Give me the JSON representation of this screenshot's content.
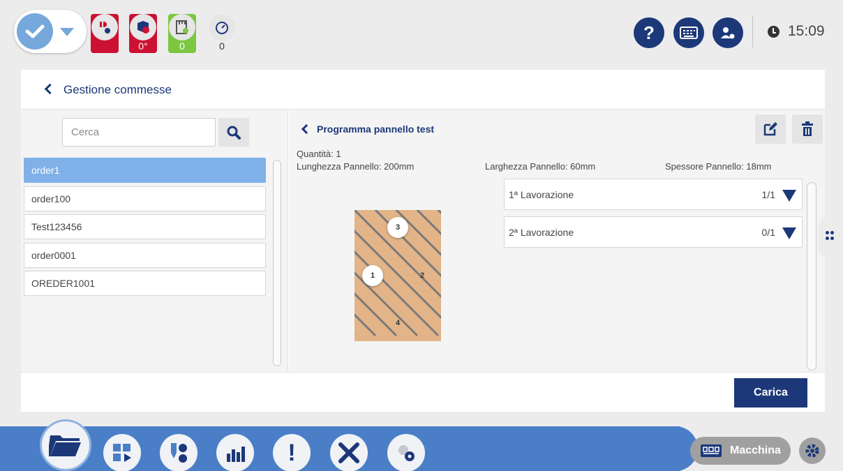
{
  "topbar": {
    "status_boxes": [
      {
        "icon": "tool-icon",
        "value": ""
      },
      {
        "icon": "spindle-icon",
        "value": "0°"
      },
      {
        "icon": "ruler-icon",
        "value": "0"
      },
      {
        "icon": "gauge-icon",
        "value": "0"
      }
    ],
    "clock": "15:09"
  },
  "header": {
    "title": "Gestione commesse"
  },
  "search": {
    "placeholder": "Cerca"
  },
  "orders": [
    "order1",
    "order100",
    "Test123456",
    "order0001",
    "OREDER1001"
  ],
  "program": {
    "title": "Programma pannello test",
    "quantity": "Quantità: 1",
    "length": "Lunghezza Pannello: 200mm",
    "width": "Larghezza Pannello: 60mm",
    "thickness": "Spessore Pannello: 18mm"
  },
  "panel_markers": {
    "m1": "1",
    "m2": "2",
    "m3": "3",
    "m4": "4"
  },
  "lavorazioni": [
    {
      "name": "1ª Lavorazione",
      "count": "1/1"
    },
    {
      "name": "2ª Lavorazione",
      "count": "0/1"
    }
  ],
  "footer": {
    "load_label": "Carica"
  },
  "bottombar": {
    "machine_label": "Macchina"
  },
  "colors": {
    "accent": "#1c3879",
    "selected": "#7fb1e8",
    "bar": "#4a7fc8",
    "alarm": "#cc1133",
    "ok": "#7cc742",
    "panel": "#e3b488"
  }
}
